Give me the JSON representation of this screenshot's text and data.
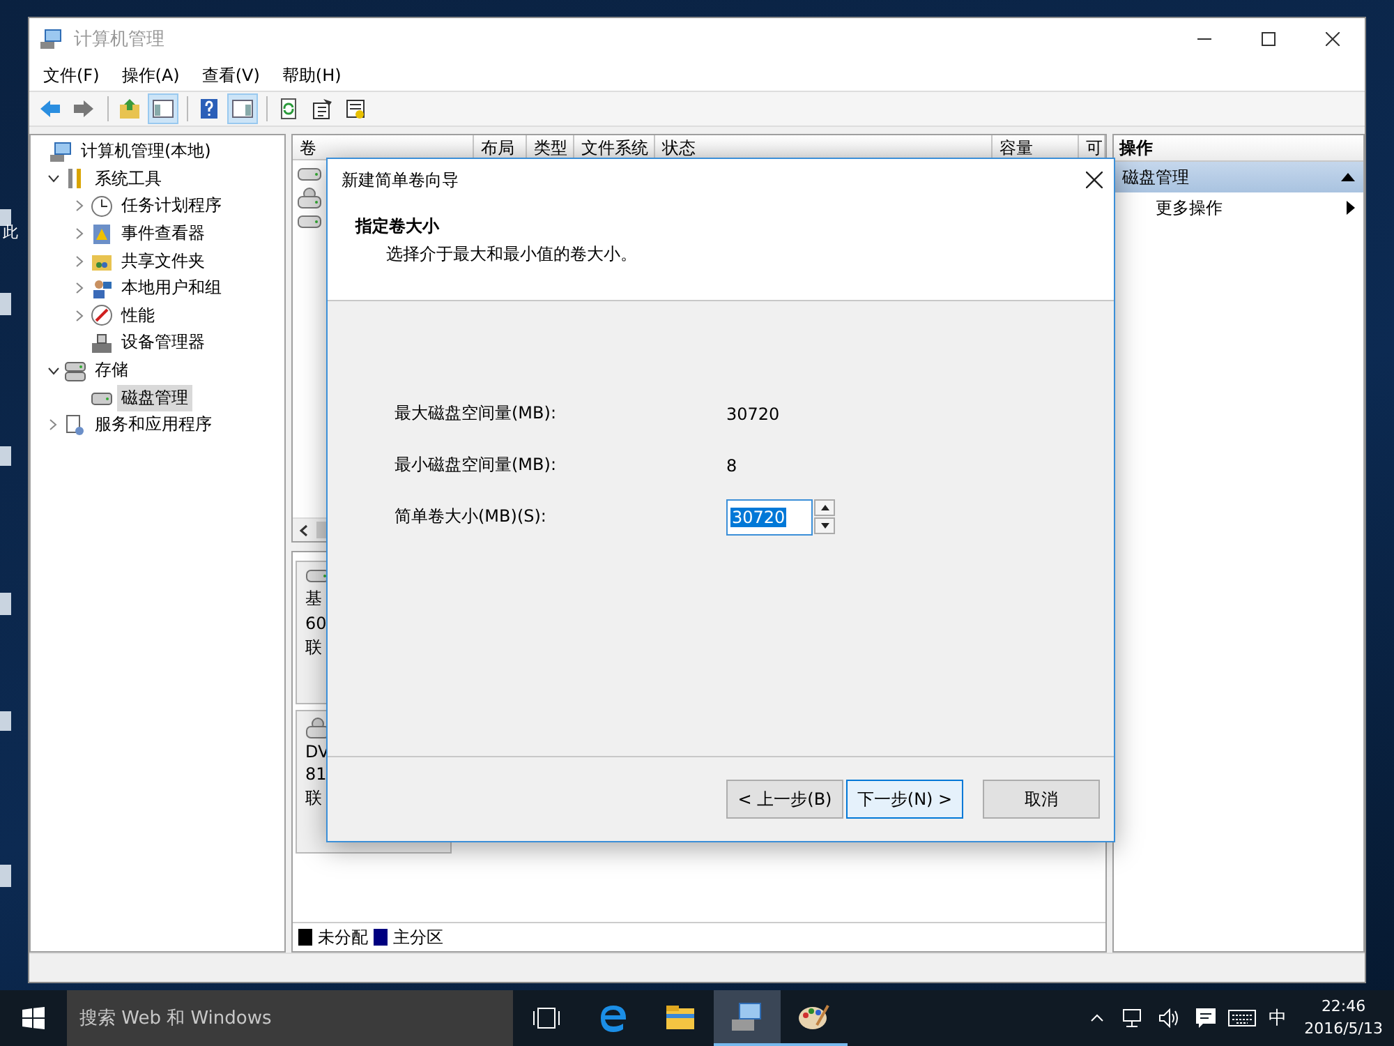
{
  "desktop": {
    "icon_label": "此"
  },
  "window": {
    "title": "计算机管理"
  },
  "menu": [
    {
      "label": "文件(F)"
    },
    {
      "label": "操作(A)"
    },
    {
      "label": "查看(V)"
    },
    {
      "label": "帮助(H)"
    }
  ],
  "toolbar": {
    "groups": [
      {
        "buttons": [
          {
            "pressed": false
          },
          {
            "pressed": false
          }
        ]
      },
      {
        "buttons": [
          {
            "pressed": false
          },
          {
            "pressed": true
          }
        ]
      },
      {
        "buttons": [
          {
            "pressed": false
          },
          {
            "pressed": true
          }
        ]
      },
      {
        "buttons": [
          {
            "pressed": false
          },
          {
            "pressed": false
          },
          {
            "pressed": false
          }
        ]
      }
    ]
  },
  "tree": [
    {
      "label": "计算机管理(本地)",
      "selected": false,
      "children": [
        {
          "label": "系统工具",
          "expanded": true,
          "selected": false,
          "children": [
            {
              "label": "任务计划程序",
              "expanded": false,
              "selected": false
            },
            {
              "label": "事件查看器",
              "expanded": false,
              "selected": false
            },
            {
              "label": "共享文件夹",
              "expanded": false,
              "selected": false
            },
            {
              "label": "本地用户和组",
              "expanded": false,
              "selected": false
            },
            {
              "label": "性能",
              "expanded": false,
              "selected": false
            },
            {
              "label": "设备管理器",
              "selected": false
            }
          ]
        },
        {
          "label": "存储",
          "expanded": true,
          "selected": false,
          "children": [
            {
              "label": "磁盘管理",
              "selected": true
            }
          ]
        },
        {
          "label": "服务和应用程序",
          "expanded": false,
          "selected": false
        }
      ]
    }
  ],
  "volume_table": {
    "columns": [
      "卷",
      "布局",
      "类型",
      "文件系统",
      "状态",
      "容量",
      "可"
    ]
  },
  "disks": [
    {
      "lines": [
        "基",
        "60",
        "联"
      ]
    },
    {
      "lines": [
        "DV",
        "81",
        "联"
      ]
    }
  ],
  "legend": [
    {
      "label": "未分配",
      "color": "#000000"
    },
    {
      "label": "主分区",
      "color": "#000080"
    }
  ],
  "actions": {
    "header": "操作",
    "sections": [
      {
        "title": "磁盘管理",
        "expanded": true,
        "items": [
          {
            "label": "更多操作"
          }
        ]
      }
    ]
  },
  "dialog": {
    "title": "新建简单卷向导",
    "heading": "指定卷大小",
    "subheading": "选择介于最大和最小值的卷大小。",
    "fields": [
      {
        "kind": "readout",
        "label": "最大磁盘空间量(MB):",
        "value": "30720"
      },
      {
        "kind": "readout",
        "label": "最小磁盘空间量(MB):",
        "value": "8"
      },
      {
        "kind": "spin",
        "label": "简单卷大小(MB)(S):",
        "value": "30720",
        "text_selected": true
      }
    ],
    "buttons": [
      {
        "label": "< 上一步(B)",
        "default": false
      },
      {
        "label": "下一步(N) >",
        "default": true
      },
      {
        "label": "取消",
        "default": false
      }
    ]
  },
  "taskbar": {
    "placeholder": "搜索 Web 和 Windows",
    "apps": [
      {
        "running": false,
        "active": false
      },
      {
        "running": false,
        "active": false
      },
      {
        "running": true,
        "active": true
      },
      {
        "running": true,
        "active": false
      }
    ],
    "ime": "中",
    "time": "22:46",
    "date": "2016/5/13"
  }
}
